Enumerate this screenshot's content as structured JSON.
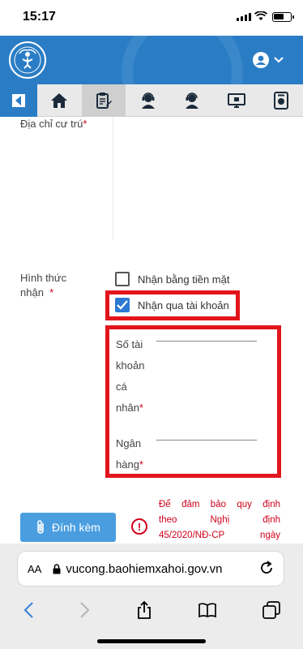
{
  "status": {
    "time": "15:17"
  },
  "header": {
    "logo_text": "BẢO HIỂM XÃ HỘI VIỆT NAM"
  },
  "tabs": [
    {
      "icon": "home-icon"
    },
    {
      "icon": "document-edit-icon",
      "active": true
    },
    {
      "icon": "support-agent-icon"
    },
    {
      "icon": "support-agent-icon"
    },
    {
      "icon": "monitor-icon"
    },
    {
      "icon": "camera-icon"
    }
  ],
  "form": {
    "address_label": "Địa chỉ cư trú",
    "receive_label_1": "Hình thức",
    "receive_label_2": "nhận",
    "required_mark": "*",
    "option_cash": "Nhận bằng tiền mặt",
    "option_account": "Nhận qua tài khoản",
    "option_account_checked": true,
    "account_label": [
      "Số tài",
      "khoản",
      "cá",
      "nhân"
    ],
    "bank_label": [
      "Ngân",
      "hàng"
    ],
    "attach_label": "Đính kèm",
    "note": "Để đảm bảo quy định theo Nghị định 45/2020/NĐ-CP ngày",
    "note_lines": [
      "Để  đảm  bảo  quy  định",
      "theo   Nghị   định",
      "45/2020/NĐ-CP  ngày"
    ]
  },
  "browser": {
    "aa_label": "AA",
    "url": "vucong.baohiemxahoi.gov.vn"
  },
  "colors": {
    "brand_blue": "#2a7dc5",
    "highlight_red": "#e3151c",
    "checkbox_blue": "#2d79d2",
    "attach_blue": "#4a9ee0"
  }
}
